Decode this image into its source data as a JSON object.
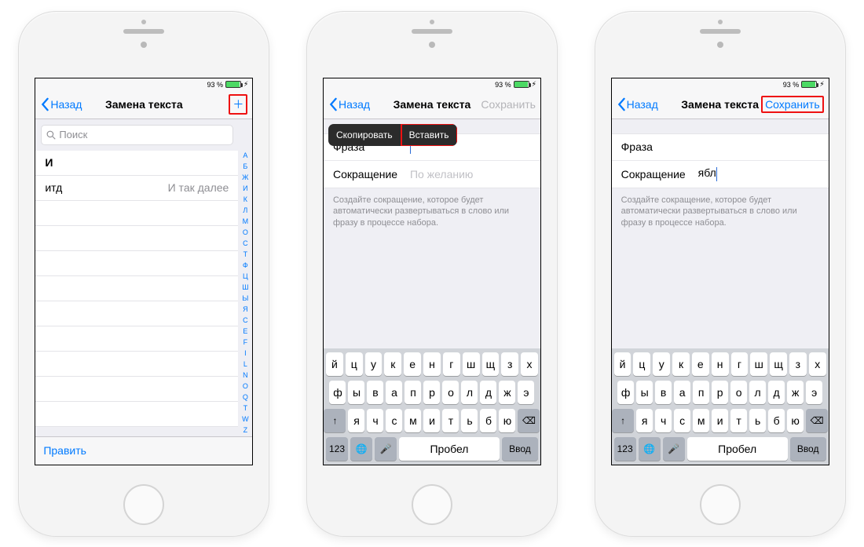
{
  "status": {
    "battery_pct": "93 %",
    "charging_glyph": "⚡︎"
  },
  "nav": {
    "back": "Назад",
    "title": "Замена текста",
    "add_glyph": "＋",
    "save": "Сохранить",
    "save_dim": "Сохранить"
  },
  "s1": {
    "search_placeholder": "Поиск",
    "rows": [
      {
        "shortcut": "и",
        "phrase": "",
        "heading": "И"
      },
      {
        "shortcut": "итд",
        "phrase": "И так далее"
      }
    ],
    "index_letters": [
      "А",
      "Б",
      "Ж",
      "И",
      "К",
      "Л",
      "М",
      "О",
      "С",
      "Т",
      "Ф",
      "Ц",
      "Ш",
      "Ы",
      "Я",
      "С",
      "Е",
      "F",
      "I",
      "L",
      "N",
      "О",
      "Q",
      "Т",
      "W",
      "Z",
      "#"
    ],
    "edit": "Править"
  },
  "form": {
    "phrase_label": "Фраза",
    "short_label": "Сокращение",
    "short_placeholder": "По желанию",
    "hint": "Создайте сокращение, которое будет автоматически развертываться в слово или фразу в процессе набора."
  },
  "s2": {
    "phrase_value": "",
    "short_value": "",
    "popup_copy": "Скопировать",
    "popup_paste": "Вставить"
  },
  "s3": {
    "phrase_value": "",
    "short_value": "ябл"
  },
  "keyboard": {
    "r1": [
      "й",
      "ц",
      "у",
      "к",
      "е",
      "н",
      "г",
      "ш",
      "щ",
      "з",
      "х"
    ],
    "r2": [
      "ф",
      "ы",
      "в",
      "а",
      "п",
      "р",
      "о",
      "л",
      "д",
      "ж",
      "э"
    ],
    "r3": [
      "я",
      "ч",
      "с",
      "м",
      "и",
      "т",
      "ь",
      "б",
      "ю"
    ],
    "shift": "↑",
    "backspace": "⌫",
    "num": "123",
    "globe": "🌐",
    "mic": "🎤",
    "space": "Пробел",
    "enter": "Ввод"
  }
}
